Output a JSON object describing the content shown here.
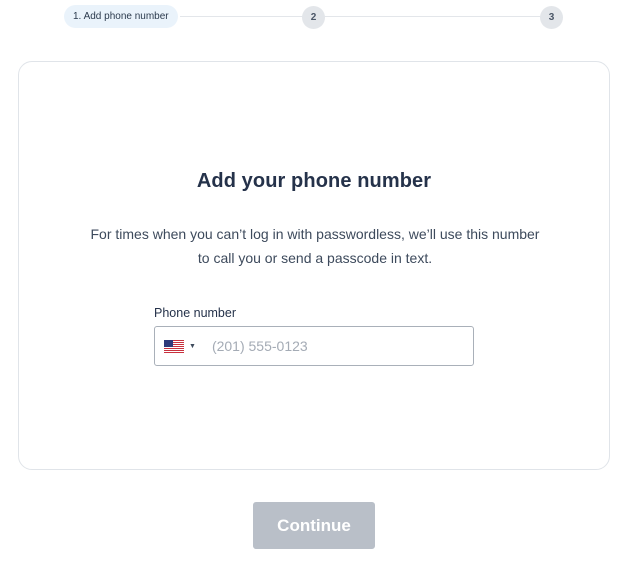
{
  "stepper": {
    "steps": [
      {
        "label": "1. Add phone number",
        "active": true
      },
      {
        "label": "2",
        "active": false
      },
      {
        "label": "3",
        "active": false
      }
    ]
  },
  "card": {
    "title": "Add your phone number",
    "description": "For times when you can’t log in with passwordless, we’ll use this number to call you or send a passcode in text.",
    "phone_label": "Phone number",
    "phone_placeholder": "(201) 555-0123",
    "phone_value": "",
    "country_flag": "us-flag-icon"
  },
  "actions": {
    "continue_label": "Continue",
    "continue_enabled": false
  },
  "colors": {
    "active_step_bg": "#eaf3fb",
    "inactive_step_bg": "#e3e6ea",
    "button_disabled_bg": "#b9bfc8",
    "title_text": "#25324a"
  }
}
